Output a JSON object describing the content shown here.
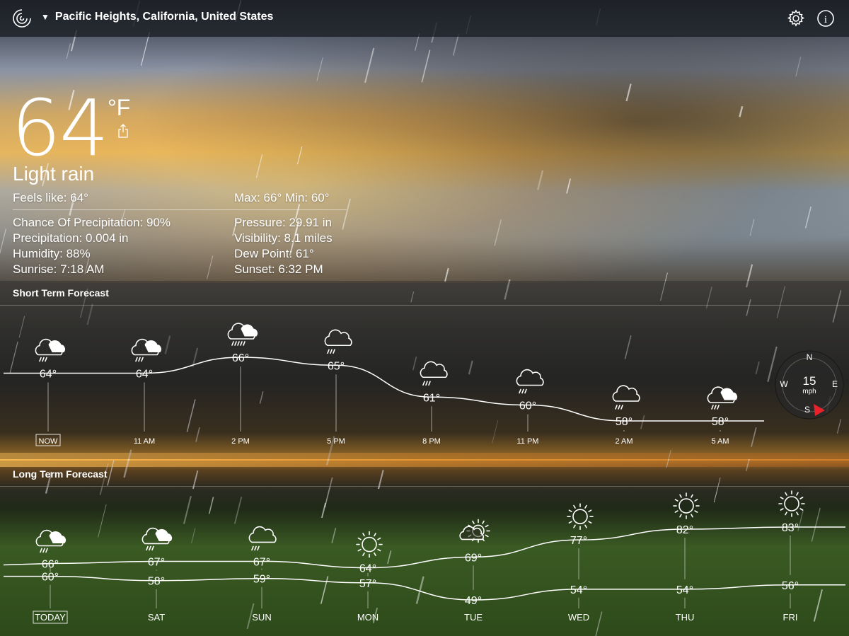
{
  "location": "Pacific Heights, California, United States",
  "current": {
    "temp": "64",
    "unit": "°F",
    "condition": "Light rain",
    "feels_like": "Feels like: 64°",
    "maxmin": "Max: 66°  Min: 60°",
    "precip_chance": "Chance Of Precipitation: 90%",
    "precip": "Precipitation: 0.004 in",
    "humidity": "Humidity: 88%",
    "sunrise": "Sunrise: 7:18 AM",
    "pressure": "Pressure: 29.91 in",
    "visibility": "Visibility: 8.1 miles",
    "dew_point": "Dew Point: 61°",
    "sunset": "Sunset: 6:32 PM"
  },
  "short_term": {
    "title": "Short Term Forecast",
    "items": [
      {
        "time": "NOW",
        "temp": "64°",
        "value": 64,
        "icon": "cloud-sun-rain-icon"
      },
      {
        "time": "11 AM",
        "temp": "64°",
        "value": 64,
        "icon": "cloud-sun-rain-icon"
      },
      {
        "time": "2 PM",
        "temp": "66°",
        "value": 66,
        "icon": "cloud-sun-heavy-rain-icon"
      },
      {
        "time": "5 PM",
        "temp": "65°",
        "value": 65,
        "icon": "cloud-rain-icon"
      },
      {
        "time": "8 PM",
        "temp": "61°",
        "value": 61,
        "icon": "cloud-rain-icon"
      },
      {
        "time": "11 PM",
        "temp": "60°",
        "value": 60,
        "icon": "cloud-rain-icon"
      },
      {
        "time": "2 AM",
        "temp": "58°",
        "value": 58,
        "icon": "cloud-rain-icon"
      },
      {
        "time": "5 AM",
        "temp": "58°",
        "value": 58,
        "icon": "cloud-sun-rain-icon"
      }
    ]
  },
  "wind": {
    "speed": "15",
    "unit": "mph",
    "n": "N",
    "s": "S",
    "e": "E",
    "w": "W"
  },
  "long_term": {
    "title": "Long Term Forecast",
    "items": [
      {
        "day": "TODAY",
        "high": "66°",
        "low": "60°",
        "high_value": 66,
        "low_value": 60,
        "icon": "cloud-sun-rain-icon"
      },
      {
        "day": "SAT",
        "high": "67°",
        "low": "58°",
        "high_value": 67,
        "low_value": 58,
        "icon": "cloud-sun-rain-icon"
      },
      {
        "day": "SUN",
        "high": "67°",
        "low": "59°",
        "high_value": 67,
        "low_value": 59,
        "icon": "cloud-rain-icon"
      },
      {
        "day": "MON",
        "high": "64°",
        "low": "57°",
        "high_value": 64,
        "low_value": 57,
        "icon": "sun-icon"
      },
      {
        "day": "TUE",
        "high": "69°",
        "low": "49°",
        "high_value": 69,
        "low_value": 49,
        "icon": "sun-cloud-icon"
      },
      {
        "day": "WED",
        "high": "77°",
        "low": "54°",
        "high_value": 77,
        "low_value": 54,
        "icon": "sun-icon"
      },
      {
        "day": "THU",
        "high": "82°",
        "low": "54°",
        "high_value": 82,
        "low_value": 54,
        "icon": "sun-icon"
      },
      {
        "day": "FRI",
        "high": "83°",
        "low": "56°",
        "high_value": 83,
        "low_value": 56,
        "icon": "sun-icon"
      }
    ]
  },
  "colors": {
    "accent": "#e8212a",
    "panel": "#141618"
  }
}
